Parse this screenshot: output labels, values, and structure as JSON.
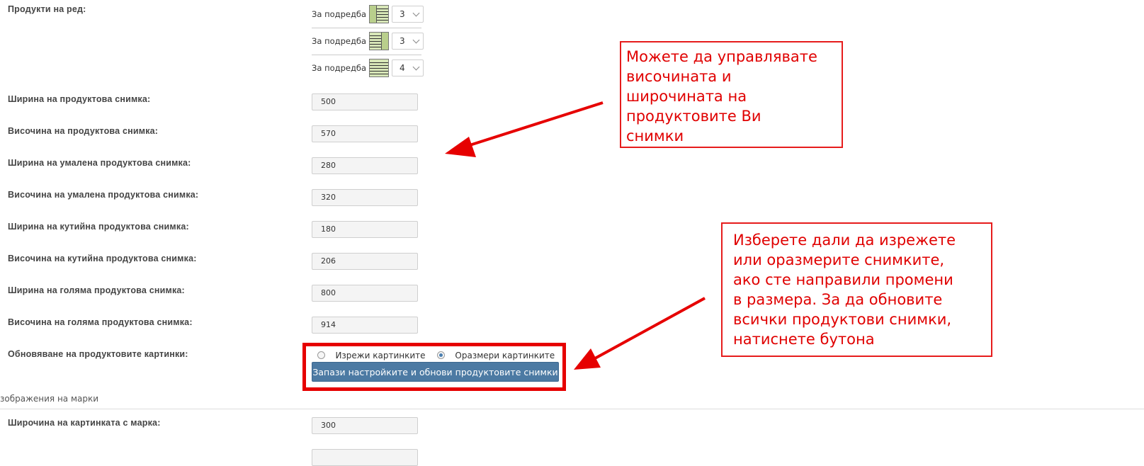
{
  "products_per_row": {
    "label": "Продукти на ред:",
    "options": [
      {
        "text": "За подредба",
        "icon": "layout-left-sidebar-icon",
        "value": "3"
      },
      {
        "text": "За подредба",
        "icon": "layout-right-sidebar-icon",
        "value": "3"
      },
      {
        "text": "За подредба",
        "icon": "layout-full-width-icon",
        "value": "4"
      }
    ]
  },
  "image_sizes": [
    {
      "label": "Ширина на продуктова снимка:",
      "value": "500"
    },
    {
      "label": "Височина на продуктова снимка:",
      "value": "570"
    },
    {
      "label": "Ширина на умалена продуктова снимка:",
      "value": "280"
    },
    {
      "label": "Височина на умалена продуктова снимка:",
      "value": "320"
    },
    {
      "label": "Ширина на кутийна продуктова снимка:",
      "value": "180"
    },
    {
      "label": "Височина на кутийна продуктова снимка:",
      "value": "206"
    },
    {
      "label": "Ширина на голяма продуктова снимка:",
      "value": "800"
    },
    {
      "label": "Височина на голяма продуктова снимка:",
      "value": "914"
    }
  ],
  "update_images": {
    "label": "Обновяване на продуктовите картинки:",
    "radio_crop": "Изрежи картинките",
    "radio_resize": "Оразмери картинките",
    "selected": "resize",
    "button": "Запази настройките и обнови продуктовите снимки"
  },
  "brand_section": {
    "title": "зображения на марки",
    "width_label": "Широчина на картинката с марка:",
    "width_value": "300"
  },
  "callouts": {
    "top": [
      "Можете да управлявате",
      "височината и",
      "широчината на",
      "продуктовите Ви",
      "снимки"
    ],
    "bottom": [
      "Изберете дали да изрежете",
      "или оразмерите снимките,",
      "ако сте направили промени",
      "в размера. За да обновите",
      "всички продуктови снимки,",
      "натиснете бутона"
    ]
  },
  "colors": {
    "annotation": "#e60000",
    "button": "#4c7aa3",
    "layout_icon": "#d7e6b7"
  }
}
